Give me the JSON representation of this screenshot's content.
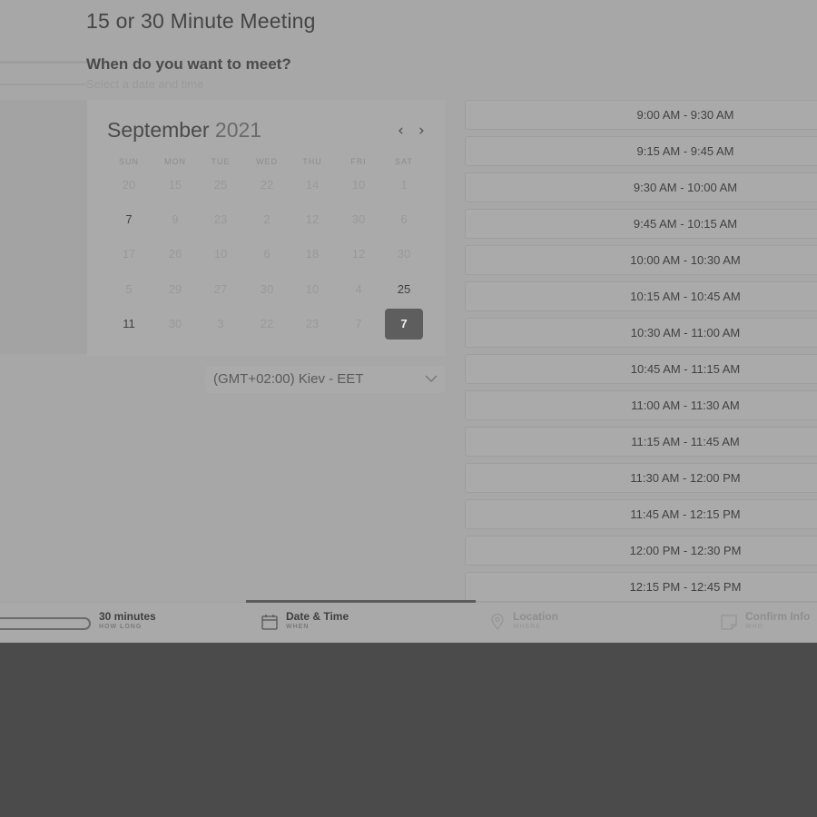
{
  "meeting": {
    "title": "15 or 30 Minute Meeting",
    "question": "When do you want to meet?",
    "hint": "Select a date and time"
  },
  "calendar": {
    "month": "September",
    "year": "2021",
    "prev_icon": "chevron-left-icon",
    "next_icon": "chevron-right-icon",
    "weekdays": [
      "SUN",
      "MON",
      "TUE",
      "WED",
      "THU",
      "FRI",
      "SAT"
    ],
    "weeks": [
      [
        "20",
        "15",
        "25",
        "22",
        "14",
        "10",
        "1"
      ],
      [
        "7",
        "9",
        "23",
        "2",
        "12",
        "30",
        "6"
      ],
      [
        "17",
        "26",
        "10",
        "6",
        "18",
        "12",
        "30"
      ],
      [
        "5",
        "29",
        "27",
        "30",
        "10",
        "4",
        "25"
      ],
      [
        "11",
        "30",
        "3",
        "22",
        "23",
        "7",
        "7"
      ]
    ],
    "available": [
      [
        1,
        0
      ],
      [
        3,
        6
      ],
      [
        4,
        0
      ]
    ],
    "selected": [
      4,
      6
    ]
  },
  "timezone": {
    "label": "(GMT+02:00) Kiev - EET",
    "icon": "chevron-down-icon"
  },
  "slots": [
    "9:00 AM - 9:30 AM",
    "9:15 AM - 9:45 AM",
    "9:30 AM - 10:00 AM",
    "9:45 AM - 10:15 AM",
    "10:00 AM - 10:30 AM",
    "10:15 AM - 10:45 AM",
    "10:30 AM - 11:00 AM",
    "10:45 AM - 11:15 AM",
    "11:00 AM - 11:30 AM",
    "11:15 AM - 11:45 AM",
    "11:30 AM - 12:00 PM",
    "11:45 AM - 12:15 PM",
    "12:00 PM - 12:30 PM",
    "12:15 PM - 12:45 PM"
  ],
  "steps": {
    "duration": {
      "title": "30 minutes",
      "sub": "HOW LONG"
    },
    "datetime": {
      "title": "Date & Time",
      "sub": "WHEN",
      "icon": "calendar-icon"
    },
    "location": {
      "title": "Location",
      "sub": "WHERE",
      "icon": "map-pin-icon"
    },
    "confirm": {
      "title": "Confirm Info",
      "sub": "WHO",
      "icon": "note-icon"
    }
  },
  "colors": {
    "overlay": "#4b4b4b",
    "panel": "#a7a7a7",
    "selected_day": "#5e5e5e"
  }
}
